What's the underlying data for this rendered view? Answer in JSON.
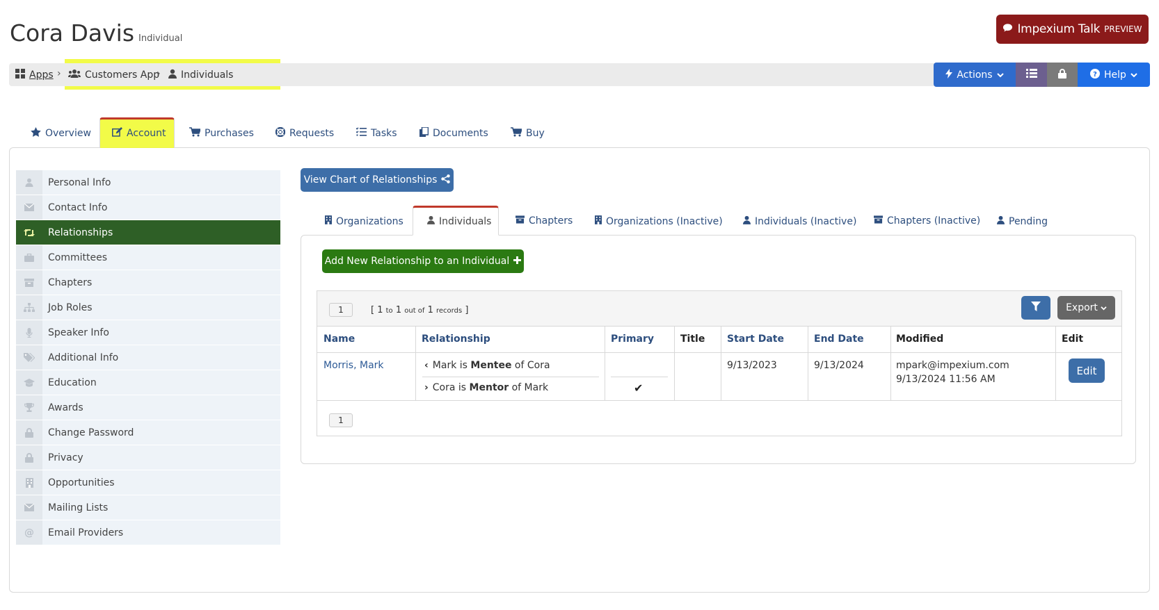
{
  "header": {
    "title": "Cora Davis",
    "subtitle": "Individual",
    "talk_button": {
      "label": "Impexium Talk",
      "badge": "PREVIEW",
      "color": "#8b1a1a"
    }
  },
  "breadcrumb": {
    "apps": "Apps",
    "customers_app": "Customers App",
    "individuals": "Individuals"
  },
  "toolbar": {
    "actions": "Actions",
    "help": "Help",
    "colors": {
      "actions": "#2f6bcc",
      "list": "#6c5f8f",
      "lock": "#7a7a7a",
      "help": "#1f6ee6"
    }
  },
  "top_tabs": [
    "Overview",
    "Account",
    "Purchases",
    "Requests",
    "Tasks",
    "Documents",
    "Buy"
  ],
  "top_tabs_active": "Account",
  "sidebar": {
    "items": [
      {
        "label": "Personal Info",
        "icon": "user-icon"
      },
      {
        "label": "Contact Info",
        "icon": "envelope-icon"
      },
      {
        "label": "Relationships",
        "icon": "retweet-icon"
      },
      {
        "label": "Committees",
        "icon": "briefcase-icon"
      },
      {
        "label": "Chapters",
        "icon": "archive-icon"
      },
      {
        "label": "Job Roles",
        "icon": "sitemap-icon"
      },
      {
        "label": "Speaker Info",
        "icon": "microphone-icon"
      },
      {
        "label": "Additional Info",
        "icon": "tags-icon"
      },
      {
        "label": "Education",
        "icon": "graduation-cap-icon"
      },
      {
        "label": "Awards",
        "icon": "trophy-icon"
      },
      {
        "label": "Change Password",
        "icon": "lock-icon"
      },
      {
        "label": "Privacy",
        "icon": "lock-icon"
      },
      {
        "label": "Opportunities",
        "icon": "building-icon"
      },
      {
        "label": "Mailing Lists",
        "icon": "envelope-icon"
      },
      {
        "label": "Email Providers",
        "icon": "at-icon"
      }
    ],
    "active": "Relationships",
    "active_color": "#2e5f26"
  },
  "content": {
    "chart_button": "View Chart of Relationships",
    "sub_tabs": [
      "Organizations",
      "Individuals",
      "Chapters",
      "Organizations (Inactive)",
      "Individuals (Inactive)",
      "Chapters (Inactive)",
      "Pending"
    ],
    "sub_tabs_active": "Individuals",
    "add_button": "Add New Relationship to an Individual"
  },
  "grid": {
    "page": "1",
    "records": {
      "open": "[",
      "from": "1",
      "to_label": "to",
      "to": "1",
      "out_of_label": "out of",
      "total": "1",
      "records_label": "records",
      "close": "]"
    },
    "export": "Export",
    "columns": [
      "Name",
      "Relationship",
      "Primary",
      "Title",
      "Start Date",
      "End Date",
      "Modified",
      "Edit"
    ],
    "row": {
      "name": "Morris, Mark",
      "rel1": {
        "subject": "Mark is",
        "role": "Mentee",
        "object": "of Cora"
      },
      "rel2": {
        "subject": "Cora is",
        "role": "Mentor",
        "object": "of Mark"
      },
      "primary": "✔",
      "title": "",
      "start_date": "9/13/2023",
      "end_date": "9/13/2024",
      "modified_by": "mpark@impexium.com",
      "modified_at": "9/13/2024 11:56 AM",
      "edit": "Edit"
    },
    "page_bottom": "1"
  }
}
